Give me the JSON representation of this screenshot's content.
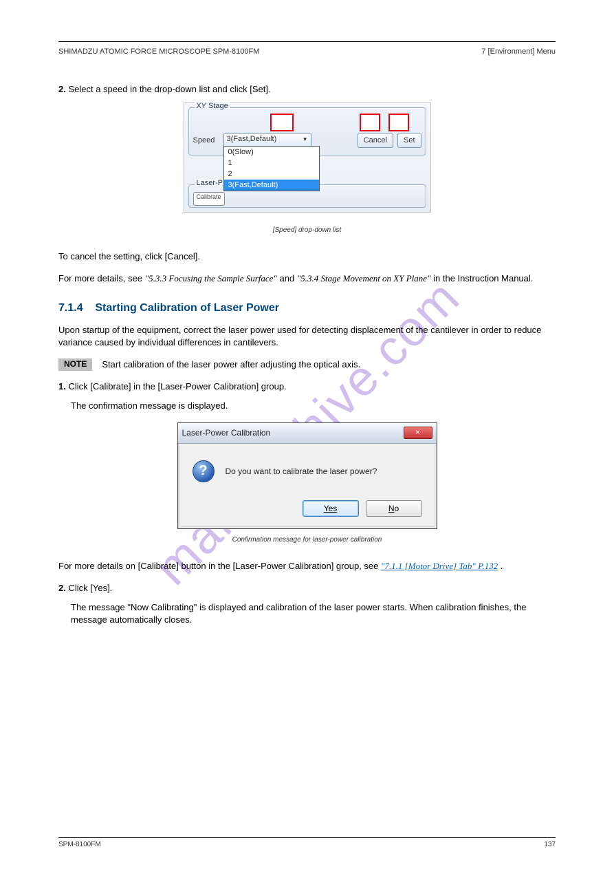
{
  "header": {
    "title": "SHIMADZU ATOMIC FORCE MICROSCOPE SPM-8100FM",
    "chapter": "7 [Environment] Menu"
  },
  "watermark": "manualshive.com",
  "step2": {
    "num": "2.",
    "text": "Select a speed in the drop-down list and click [Set]."
  },
  "xy_panel": {
    "group_title": "XY Stage",
    "speed_label": "Speed",
    "selected": "3(Fast,Default)",
    "options": [
      "0(Slow)",
      "1",
      "2",
      "3(Fast,Default)"
    ],
    "cancel": "Cancel",
    "set": "Set",
    "laser_group": "Laser-P",
    "calib_partial": "Calibrate"
  },
  "caption1": "[Speed] drop-down list",
  "para1": "To cancel the setting, click [Cancel].",
  "para2": {
    "prefix": "For more details, see ",
    "ref1": "\"5.3.3 Focusing the Sample Surface\"",
    "mid": " and ",
    "ref2": "\"5.3.4 Stage Movement on XY Plane\"",
    "suffix": " in the Instruction Manual."
  },
  "section": {
    "num": "7.1.4",
    "title": "Starting Calibration of Laser Power"
  },
  "intro": "Upon startup of the equipment, correct the laser power used for detecting displacement of the cantilever in order to reduce variance caused by individual differences in cantilevers.",
  "note": {
    "label": "NOTE",
    "text": "Start calibration of the laser power after adjusting the optical axis."
  },
  "step1b": {
    "num": "1.",
    "text": "Click [Calibrate] in the [Laser-Power Calibration] group.",
    "text2": "The confirmation message is displayed."
  },
  "dialog": {
    "title": "Laser-Power Calibration",
    "close": "×",
    "message": "Do you want to calibrate the laser power?",
    "yes": "Yes",
    "no_prefix": "N",
    "no_rest": "o"
  },
  "caption2": "Confirmation message for laser-power calibration",
  "para3": {
    "prefix": "For more details on [Calibrate] button in the [Laser-Power Calibration] group, see ",
    "link": "\"7.1.1 [Motor Drive] Tab\" P.132",
    "suffix": "."
  },
  "step2b": {
    "num": "2.",
    "text": "Click [Yes].",
    "text2": "The message \"Now Calibrating\" is displayed and calibration of the laser power starts. When calibration finishes, the message automatically closes."
  },
  "footer": {
    "left": "SPM-8100FM",
    "right": "137"
  }
}
